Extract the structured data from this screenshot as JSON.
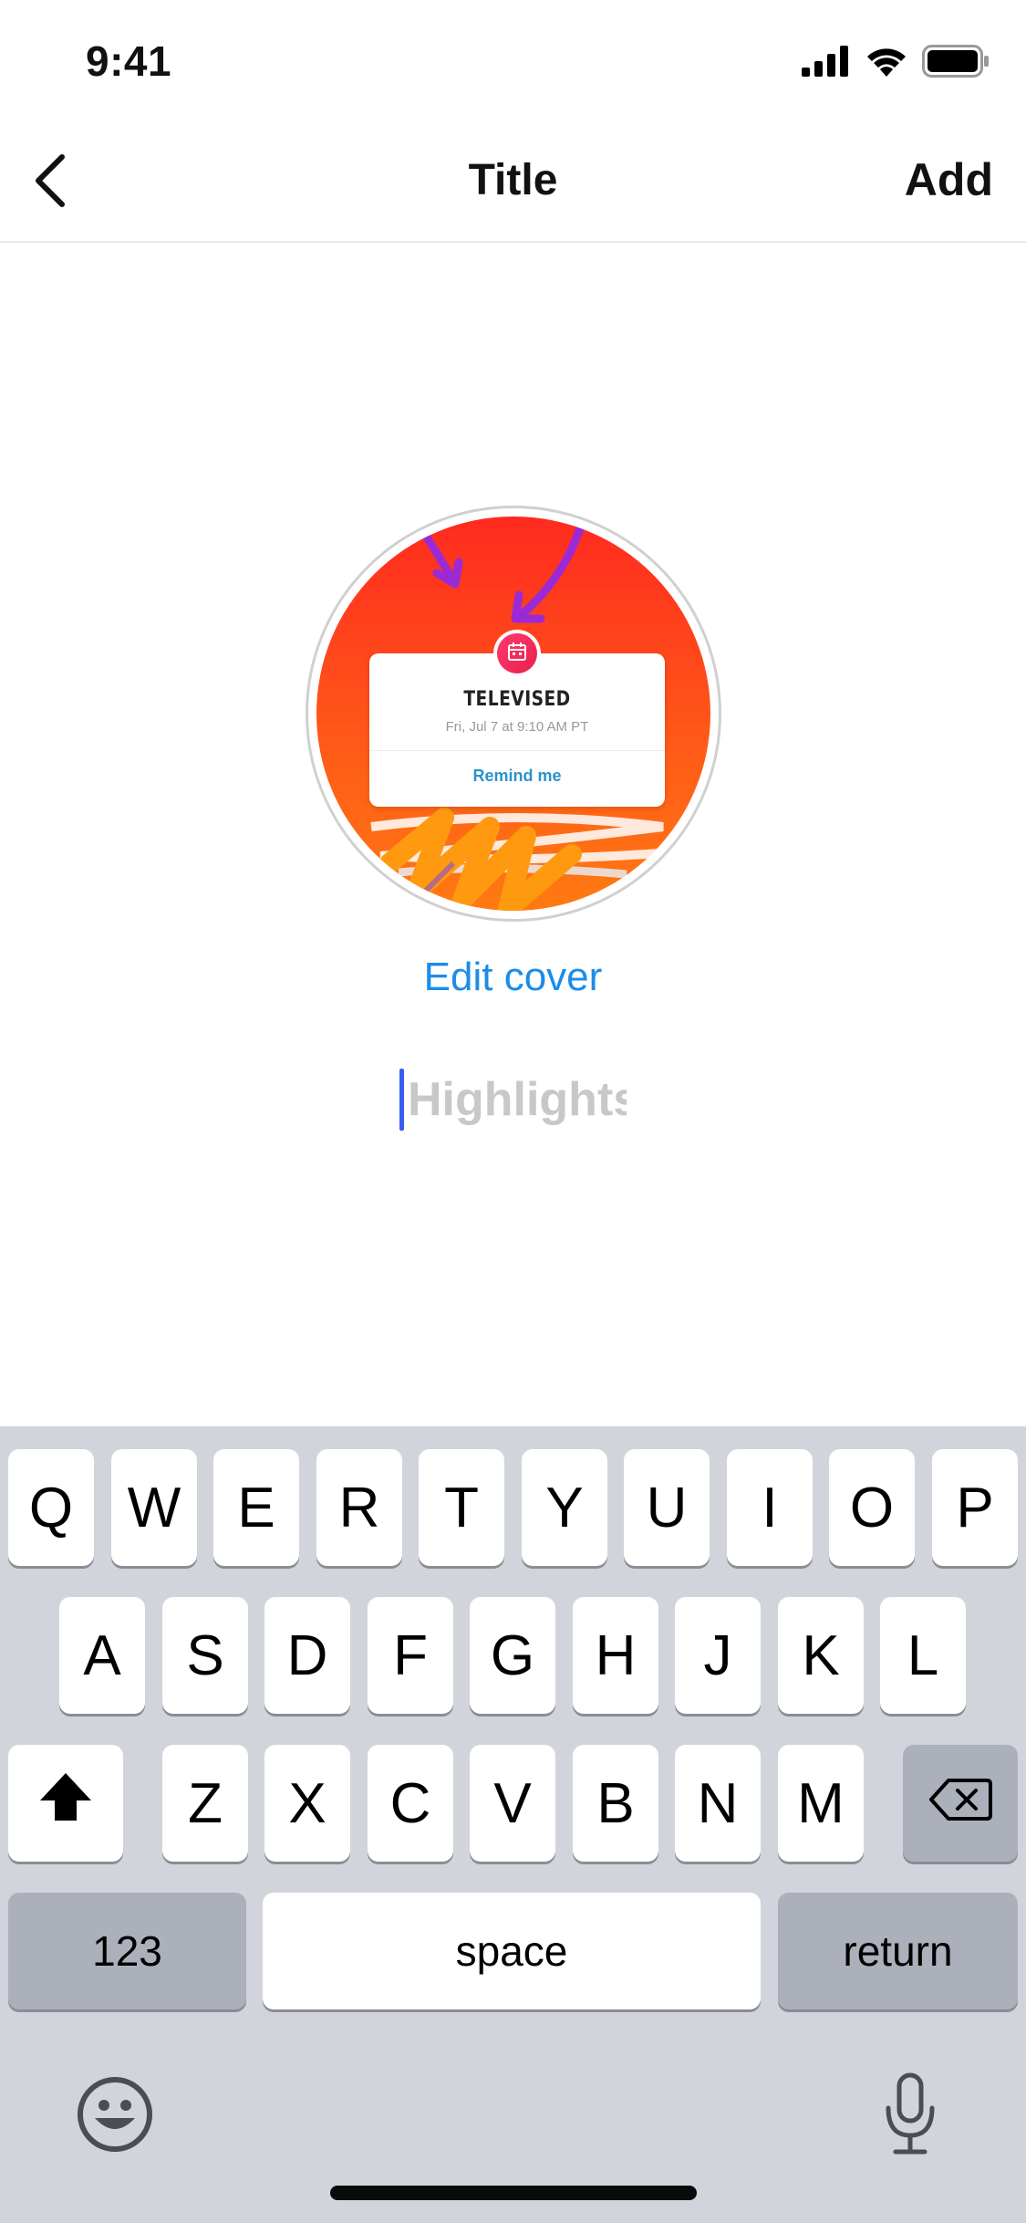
{
  "status_bar": {
    "time": "9:41"
  },
  "nav": {
    "title": "Title",
    "add_label": "Add"
  },
  "cover": {
    "card_title": "TELEVISED",
    "card_subtitle": "Fri, Jul 7 at 9:10 AM PT",
    "card_action": "Remind me",
    "edit_label": "Edit cover"
  },
  "title_input": {
    "placeholder": "Highlights",
    "value": ""
  },
  "keyboard": {
    "row1": [
      "Q",
      "W",
      "E",
      "R",
      "T",
      "Y",
      "U",
      "I",
      "O",
      "P"
    ],
    "row2": [
      "A",
      "S",
      "D",
      "F",
      "G",
      "H",
      "J",
      "K",
      "L"
    ],
    "row3": [
      "Z",
      "X",
      "C",
      "V",
      "B",
      "N",
      "M"
    ],
    "numbers_label": "123",
    "space_label": "space",
    "return_label": "return"
  },
  "colors": {
    "accent_blue": "#1c8ce8",
    "caret": "#3b5cf0",
    "keyboard_bg": "#d2d4db"
  }
}
